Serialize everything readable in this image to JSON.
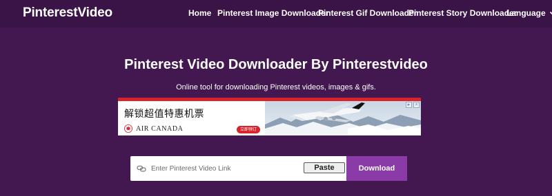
{
  "navbar": {
    "brand": "PinterestVideo",
    "links": [
      {
        "label": "Home"
      },
      {
        "label": "Pinterest Image Downloader"
      },
      {
        "label": "Pinterest Gif Downloader"
      },
      {
        "label": "Pinterest Story Downloader"
      },
      {
        "label": "Language",
        "icon": "caret-down-icon"
      }
    ]
  },
  "hero": {
    "title": "Pinterest Video Downloader By Pinterestvideo",
    "subtitle": "Online tool for downloading Pinterest videos, images & gifs."
  },
  "ad": {
    "headline": "解锁超值特惠机票",
    "brand": "AIR CANADA",
    "cta": "立即预订",
    "image": "airplane-over-snowy-mountains",
    "badge_icons": [
      "ad-choices-icon",
      "close-icon"
    ],
    "accent_color": "#d8232a"
  },
  "form": {
    "placeholder": "Enter Pinterest Video Link",
    "value": "",
    "icon": "link-icon",
    "paste_label": "Paste",
    "download_label": "Download"
  },
  "colors": {
    "page_background": "#43174f",
    "navbar_background": "#3b1447",
    "download_button": "#8b3ba8"
  }
}
